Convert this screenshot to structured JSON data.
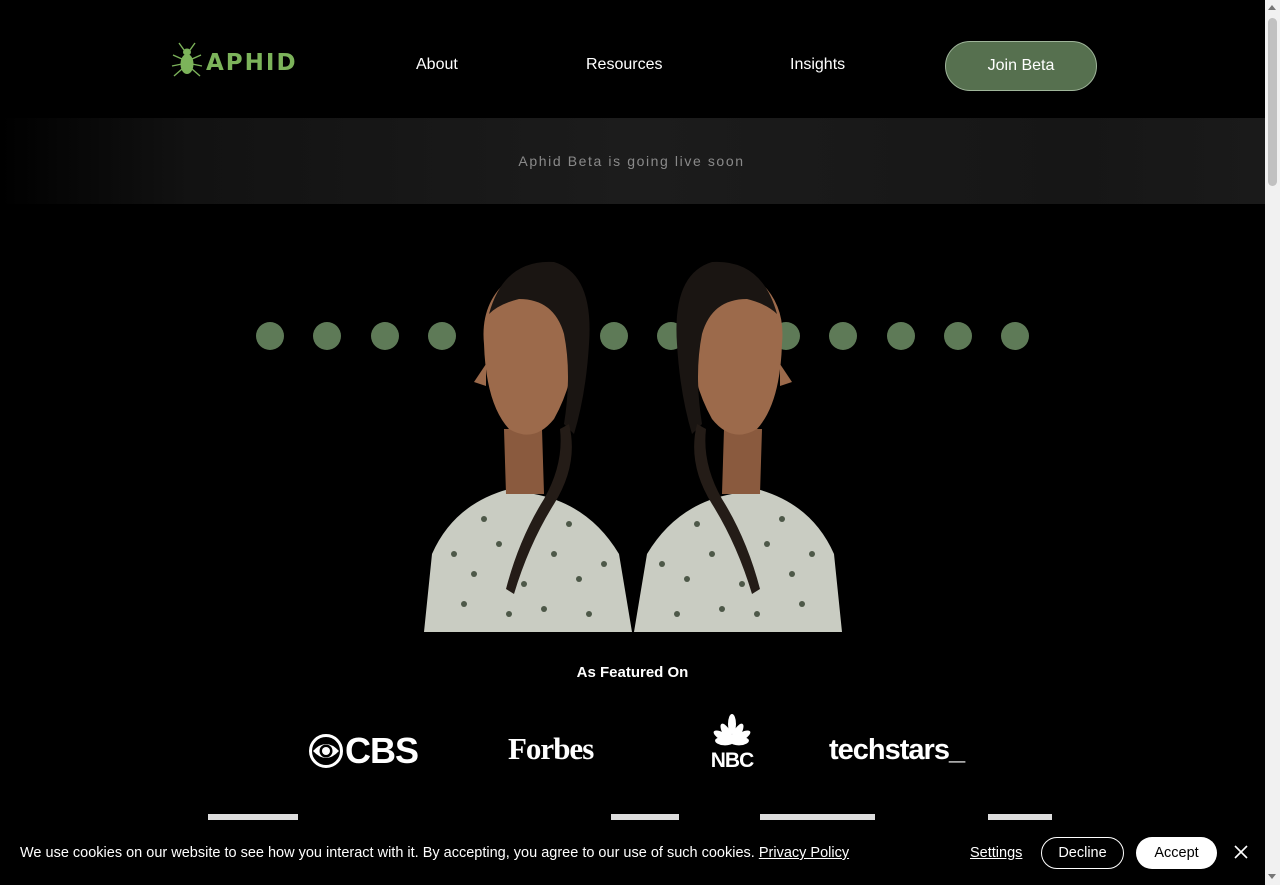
{
  "header": {
    "logo_text": "APHID",
    "nav": [
      {
        "label": "About"
      },
      {
        "label": "Resources"
      },
      {
        "label": "Insights"
      }
    ],
    "cta_label": "Join Beta"
  },
  "banner": {
    "text": "Aphid Beta is going live soon"
  },
  "hero": {
    "image_icon": "mirrored-portrait-image",
    "dot_color": "#5e7a57",
    "dot_count": 14
  },
  "featured": {
    "title": "As Featured On",
    "logos": [
      {
        "name": "CBS",
        "text": "CBS"
      },
      {
        "name": "Forbes",
        "text": "Forbes"
      },
      {
        "name": "NBC",
        "text": "NBC"
      },
      {
        "name": "techstars",
        "text": "techstars_"
      }
    ]
  },
  "cookie_banner": {
    "message": "We use cookies on our website to see how you interact with it. By accepting, you agree to our use of such cookies.",
    "policy_link": "Privacy Policy",
    "settings_label": "Settings",
    "decline_label": "Decline",
    "accept_label": "Accept",
    "close_icon": "close-icon"
  },
  "colors": {
    "background": "#000000",
    "accent": "#56704f",
    "logo_green": "#7cb35a"
  }
}
